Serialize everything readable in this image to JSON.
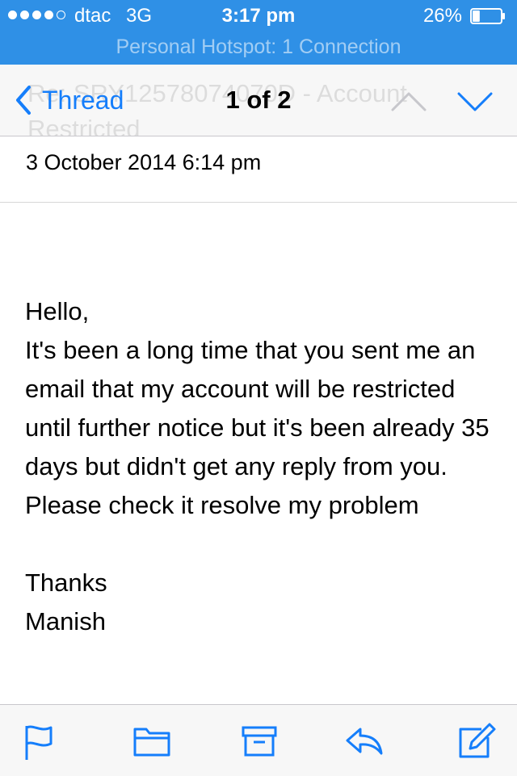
{
  "status_bar": {
    "signal_bars_filled": 4,
    "signal_bars_total": 5,
    "carrier": "dtac",
    "network": "3G",
    "time": "3:17 pm",
    "battery_percent": "26%",
    "battery_level": 0.26,
    "hotspot_banner": "Personal Hotspot: 1 Connection"
  },
  "nav": {
    "back_label": "Thread",
    "counter": "1 of 2",
    "subject_ghost": "Re: SRY12578074070D - Account Restricted"
  },
  "message": {
    "date": "3 October 2014 6:14 pm",
    "greeting": "Hello,",
    "paragraph": "It's been a long time that you sent me an email that my account will be restricted until further notice but it's been already 35 days but didn't get any reply from you.",
    "request": "Please check it resolve my problem",
    "closing": "Thanks",
    "signature": "Manish"
  },
  "toolbar": {
    "items": [
      "flag-icon",
      "folder-icon",
      "archive-icon",
      "reply-icon",
      "compose-icon"
    ]
  },
  "colors": {
    "status_bar_bg": "#2f90e6",
    "accent": "#157efb",
    "nav_bg": "#f7f7f7"
  }
}
